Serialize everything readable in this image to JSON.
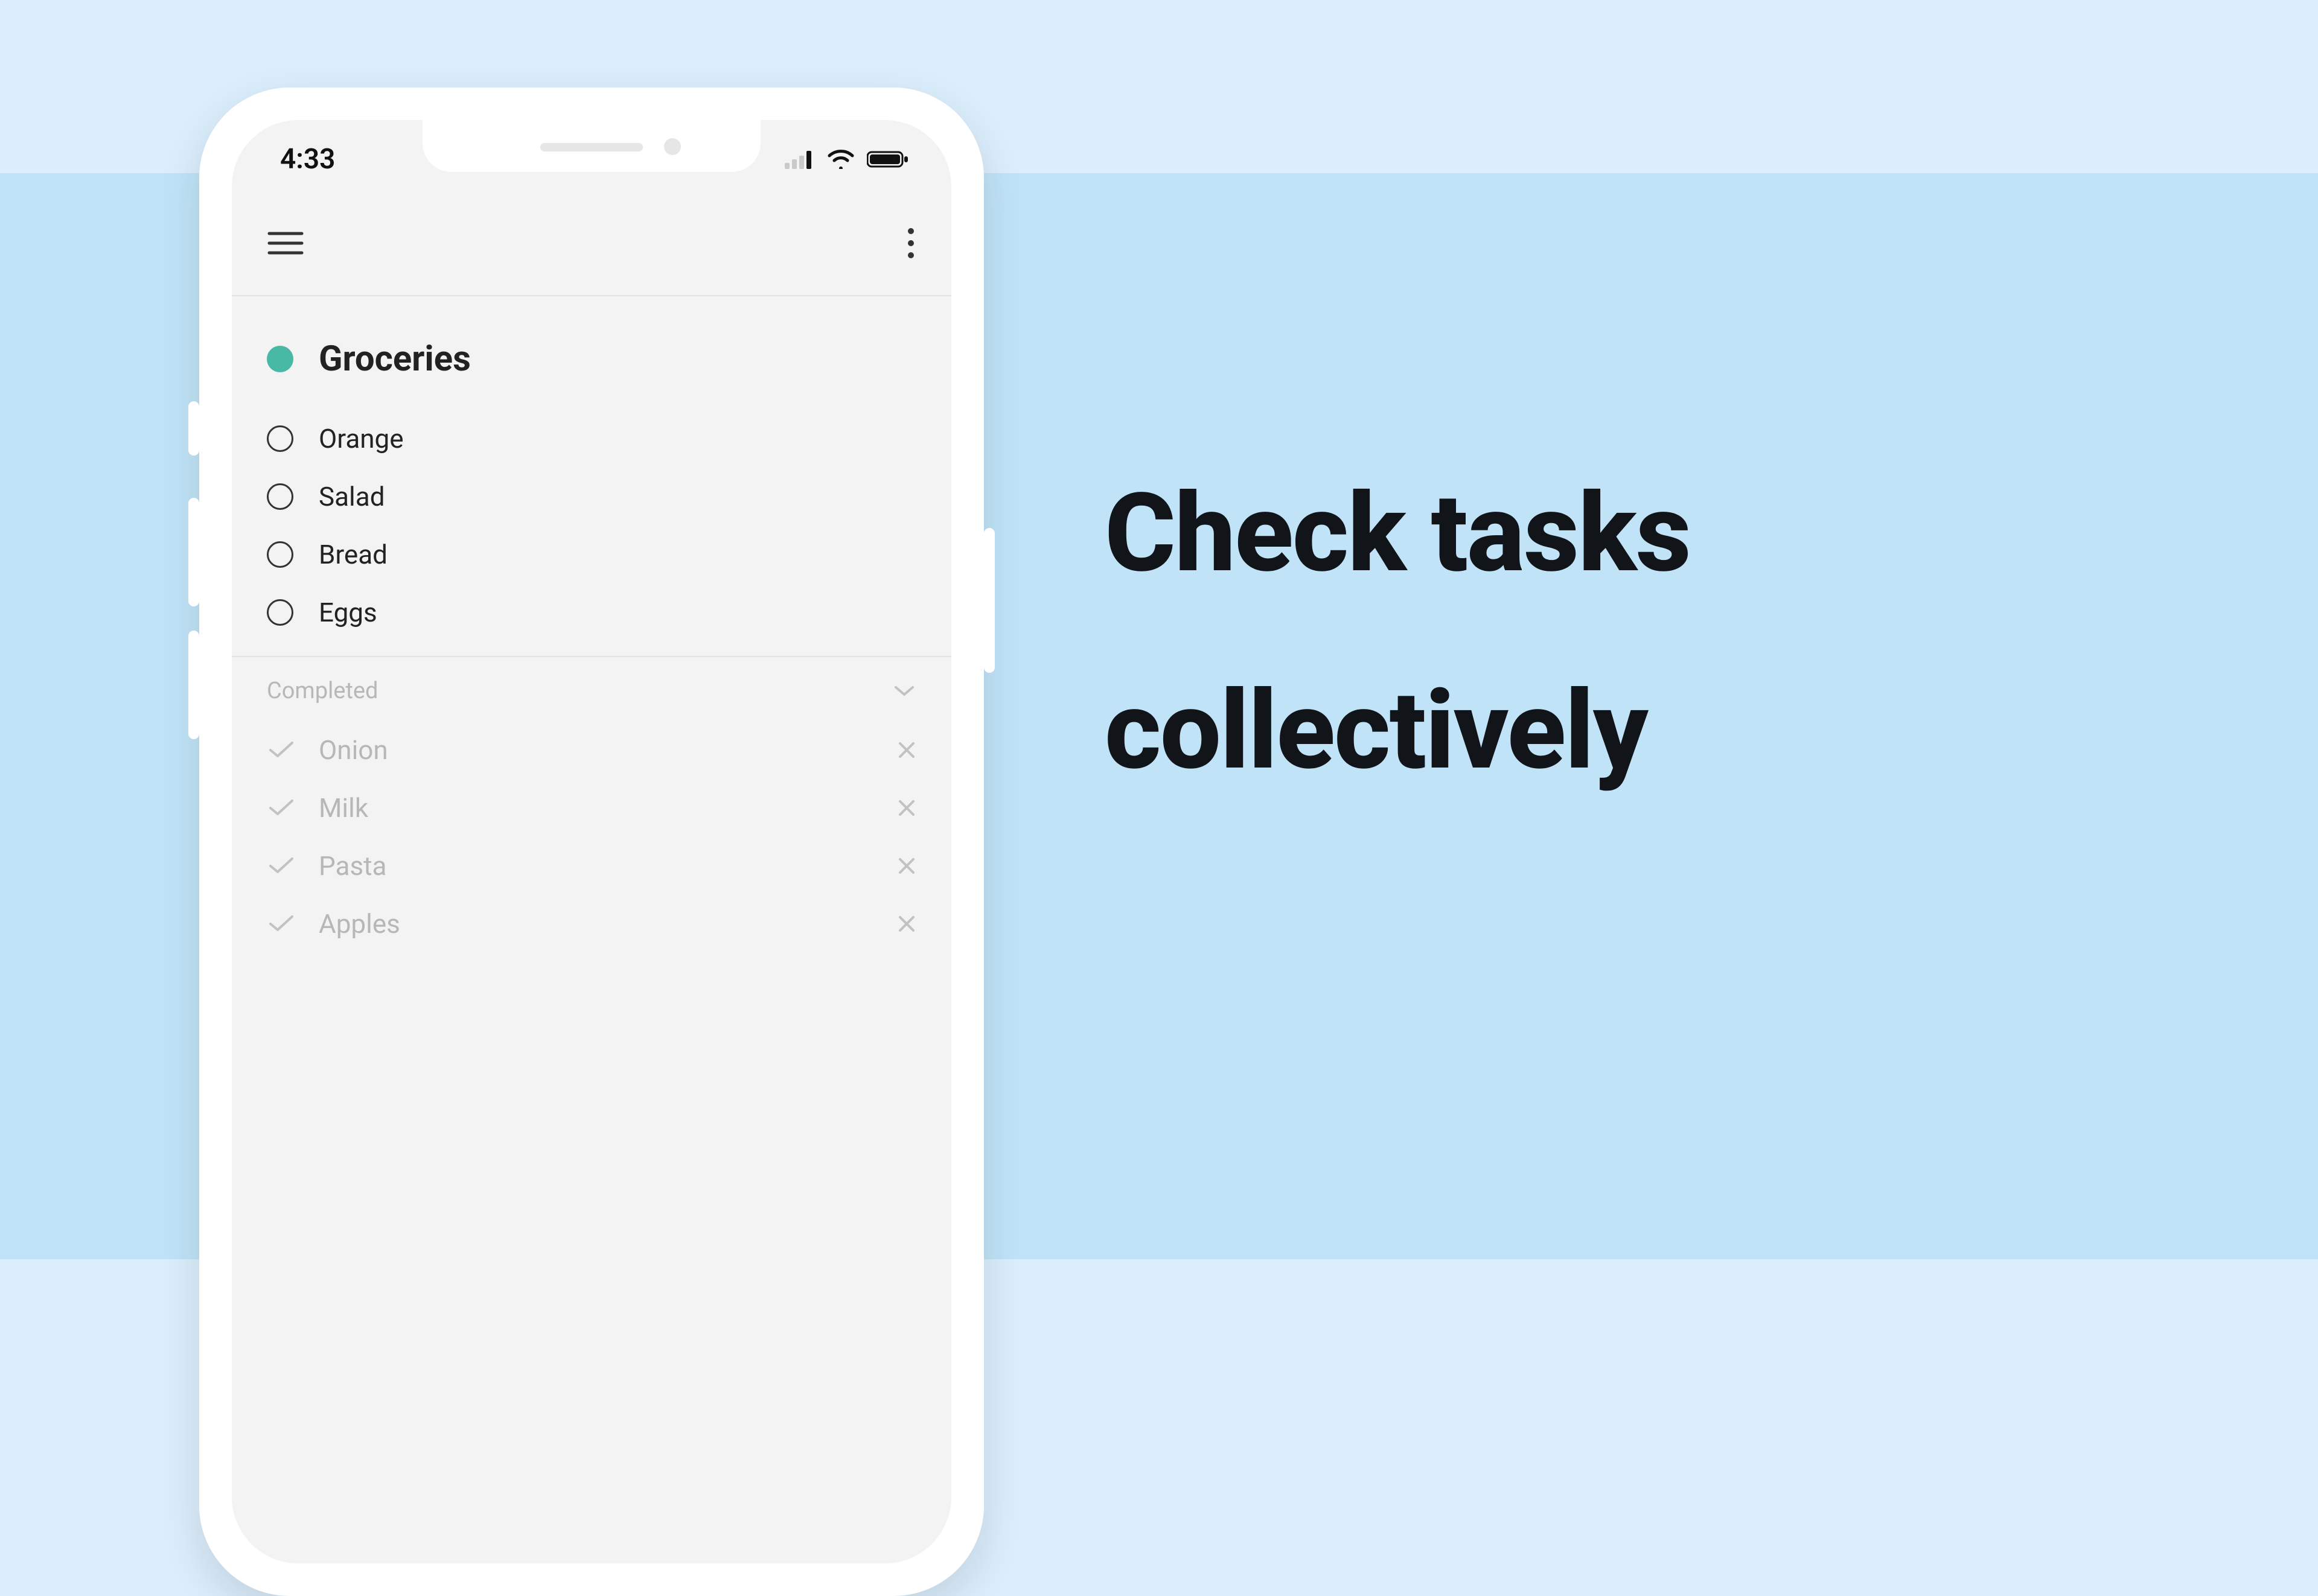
{
  "statusBar": {
    "time": "4:33"
  },
  "appBar": {
    "menuIcon": "hamburger-icon",
    "moreIcon": "kebab-icon"
  },
  "list": {
    "title": "Groceries",
    "accentColor": "#48b9a5",
    "tasks": [
      {
        "label": "Orange"
      },
      {
        "label": "Salad"
      },
      {
        "label": "Bread"
      },
      {
        "label": "Eggs"
      }
    ],
    "completedSection": {
      "label": "Completed",
      "items": [
        {
          "label": "Onion"
        },
        {
          "label": "Milk"
        },
        {
          "label": "Pasta"
        },
        {
          "label": "Apples"
        }
      ]
    }
  },
  "headline": {
    "line1": "Check tasks",
    "line2": "collectively"
  }
}
